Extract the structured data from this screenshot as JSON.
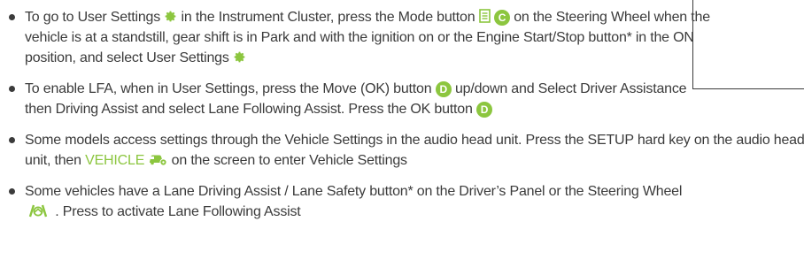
{
  "colors": {
    "accent_green": "#8cc63f",
    "text": "#3b3b3b"
  },
  "bullets": {
    "b1": {
      "t1": "To go to User Settings",
      "t2": "in the Instrument Cluster, press the Mode button",
      "badge": "C",
      "t3": "on the Steering Wheel when the vehicle is at a standstill, gear shift is in Park and with the ignition on or the Engine Start/Stop button* in the ON position, and select User Settings"
    },
    "b2": {
      "t1": "To enable LFA, when in User Settings, press the Move (OK) button",
      "badge1": "D",
      "t2": "up/down and Select Driver Assistance then Driving Assist and select Lane Following Assist. Press the OK button",
      "badge2": "D"
    },
    "b3": {
      "t1": "Some models access settings through the Vehicle Settings in the audio head unit. Press the SETUP hard key on the audio head unit, then",
      "vehicle_label": "VEHICLE",
      "t2": "on the screen to enter Vehicle Settings"
    },
    "b4": {
      "t1": "Some vehicles have a Lane Driving Assist / Lane Safety button* on the Driver’s Panel or the Steering Wheel",
      "t2": ". Press to activate Lane Following Assist"
    }
  },
  "icons": [
    "gear-icon",
    "mode-button-icon",
    "vehicle-settings-icon",
    "lane-assist-icon"
  ]
}
